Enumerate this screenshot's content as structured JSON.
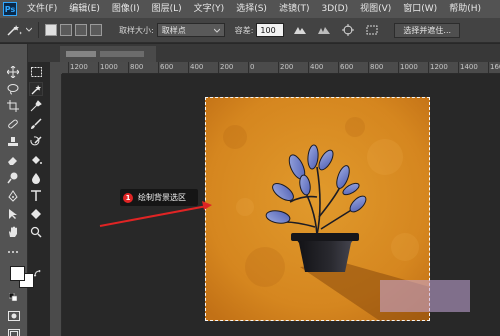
{
  "app": {
    "logo": "Ps"
  },
  "menu": [
    "文件(F)",
    "编辑(E)",
    "图像(I)",
    "图层(L)",
    "文字(Y)",
    "选择(S)",
    "滤镜(T)",
    "3D(D)",
    "视图(V)",
    "窗口(W)",
    "帮助(H)"
  ],
  "options": {
    "sample_size_label": "取样大小:",
    "sample_size_value": "取样点",
    "tolerance_label": "容差:",
    "tolerance_value": "100",
    "select_mask_button": "选择并遮住..."
  },
  "ruler": {
    "top_ticks": [
      "1200",
      "1000",
      "800",
      "600",
      "400",
      "200",
      "0",
      "200",
      "400",
      "600",
      "800",
      "1000",
      "1200",
      "1400",
      "1600",
      "1800"
    ]
  },
  "annotation": {
    "number": "1",
    "text": "绘制背景选区"
  },
  "colors": {
    "canvas_orange": "#d4831e",
    "marquee": "#ffffff",
    "callout_badge": "#e02424",
    "arrow": "#e02424"
  },
  "icons": {
    "magic_wand": "magic-wand-icon",
    "move": "move-icon",
    "marquee": "rect-marquee-icon",
    "lasso": "lasso-icon",
    "crop": "crop-icon",
    "eyedropper": "eyedropper-icon",
    "brush": "brush-icon",
    "stamp": "stamp-icon",
    "eraser": "eraser-icon",
    "bucket": "bucket-icon",
    "pen": "pen-icon",
    "text": "text-icon",
    "hand": "hand-icon",
    "zoom": "zoom-icon"
  }
}
